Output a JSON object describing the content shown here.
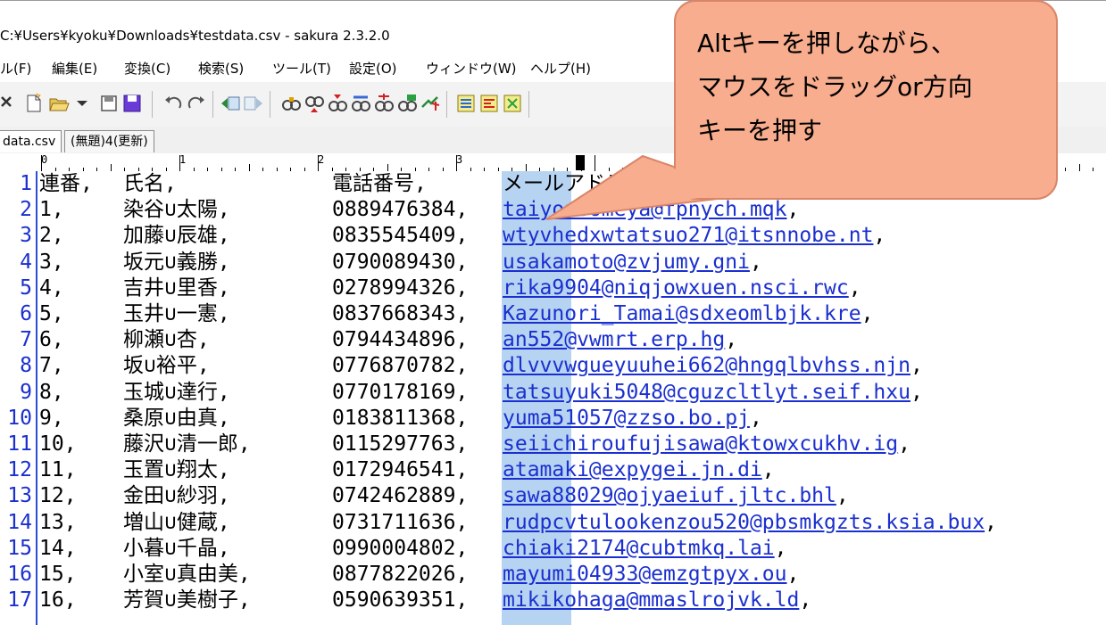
{
  "window": {
    "title": "C:¥Users¥kyoku¥Downloads¥testdata.csv - sakura 2.3.2.0"
  },
  "menu": [
    {
      "label": "ル(F)"
    },
    {
      "label": "編集(E)"
    },
    {
      "label": "変換(C)"
    },
    {
      "label": "検索(S)"
    },
    {
      "label": "ツール(T)"
    },
    {
      "label": "設定(O)"
    },
    {
      "label": "ウィンドウ(W)"
    },
    {
      "label": "ヘルプ(H)"
    }
  ],
  "toolbar_icons": [
    "close-icon",
    "new-file-icon",
    "open-folder-icon",
    "dropdown-icon",
    "save-icon",
    "save-all-icon",
    "undo-icon",
    "redo-icon",
    "jump-prev-icon",
    "jump-next-icon",
    "search-icon",
    "find-next-icon",
    "find-prev-icon",
    "replace-icon",
    "grep-icon",
    "grep-replace-icon",
    "tag-jump-icon",
    "compare-icon",
    "outline-icon",
    "macro-icon"
  ],
  "tabs": [
    {
      "label": "data.csv",
      "active": true
    },
    {
      "label": "(無題)4(更新)",
      "active": false
    }
  ],
  "ruler": {
    "labels": [
      "0",
      "1",
      "2",
      "3"
    ]
  },
  "rows": [
    {
      "ln": "1",
      "id": "連番,",
      "name": "氏名,",
      "tel": "電話番号,",
      "mail": "メールアドレス",
      "mail_is_link": false
    },
    {
      "ln": "2",
      "id": "1,",
      "name": "染谷∪太陽,",
      "tel": "0889476384,",
      "mail": "taiyousomeya@fpnych.mqk",
      "mail_is_link": true
    },
    {
      "ln": "3",
      "id": "2,",
      "name": "加藤∪辰雄,",
      "tel": "0835545409,",
      "mail": "wtyvhedxwtatsuo271@itsnnobe.nt",
      "mail_is_link": true
    },
    {
      "ln": "4",
      "id": "3,",
      "name": "坂元∪義勝,",
      "tel": "0790089430,",
      "mail": "usakamoto@zvjumy.gni",
      "mail_is_link": true
    },
    {
      "ln": "5",
      "id": "4,",
      "name": "吉井∪里香,",
      "tel": "0278994326,",
      "mail": "rika9904@niqjowxuen.nsci.rwc",
      "mail_is_link": true
    },
    {
      "ln": "6",
      "id": "5,",
      "name": "玉井∪一憲,",
      "tel": "0837668343,",
      "mail": "Kazunori_Tamai@sdxeomlbjk.kre",
      "mail_is_link": true
    },
    {
      "ln": "7",
      "id": "6,",
      "name": "柳瀬∪杏,",
      "tel": "0794434896,",
      "mail": "an552@vwmrt.erp.hg",
      "mail_is_link": true
    },
    {
      "ln": "8",
      "id": "7,",
      "name": "坂∪裕平,",
      "tel": "0776870782,",
      "mail": "dlvvvwgueyuuhei662@hngqlbvhss.njn",
      "mail_is_link": true
    },
    {
      "ln": "9",
      "id": "8,",
      "name": "玉城∪達行,",
      "tel": "0770178169,",
      "mail": "tatsuyuki5048@cguzcltlyt.seif.hxu",
      "mail_is_link": true
    },
    {
      "ln": "10",
      "id": "9,",
      "name": "桑原∪由真,",
      "tel": "0183811368,",
      "mail": "yuma51057@zzso.bo.pj",
      "mail_is_link": true
    },
    {
      "ln": "11",
      "id": "10,",
      "name": "藤沢∪清一郎,",
      "tel": "0115297763,",
      "mail": "seiichiroufujisawa@ktowxcukhv.ig",
      "mail_is_link": true
    },
    {
      "ln": "12",
      "id": "11,",
      "name": "玉置∪翔太,",
      "tel": "0172946541,",
      "mail": "atamaki@expygei.jn.di",
      "mail_is_link": true
    },
    {
      "ln": "13",
      "id": "12,",
      "name": "金田∪紗羽,",
      "tel": "0742462889,",
      "mail": "sawa88029@ojyaeiuf.jltc.bhl",
      "mail_is_link": true
    },
    {
      "ln": "14",
      "id": "13,",
      "name": "増山∪健蔵,",
      "tel": "0731711636,",
      "mail": "rudpcvtulookenzou520@pbsmkgzts.ksia.bux",
      "mail_is_link": true
    },
    {
      "ln": "15",
      "id": "14,",
      "name": "小暮∪千晶,",
      "tel": "0990004802,",
      "mail": "chiaki2174@cubtmkq.lai",
      "mail_is_link": true
    },
    {
      "ln": "16",
      "id": "15,",
      "name": "小室∪真由美,",
      "tel": "0877822026,",
      "mail": "mayumi04933@emzgtpyx.ou",
      "mail_is_link": true
    },
    {
      "ln": "17",
      "id": "16,",
      "name": "芳賀∪美樹子,",
      "tel": "0590639351,",
      "mail": "mikikohaga@mmaslrojvk.ld",
      "mail_is_link": true
    }
  ],
  "callout": {
    "lines": [
      "Altキーを押しながら、",
      "マウスをドラッグor方向",
      "キーを押す"
    ],
    "fill": "#f7ad8e",
    "border": "#d9856a"
  },
  "colors": {
    "line_number": "#1a2fcf",
    "link": "#1a2fcf",
    "selection": "#b7d3f2"
  }
}
